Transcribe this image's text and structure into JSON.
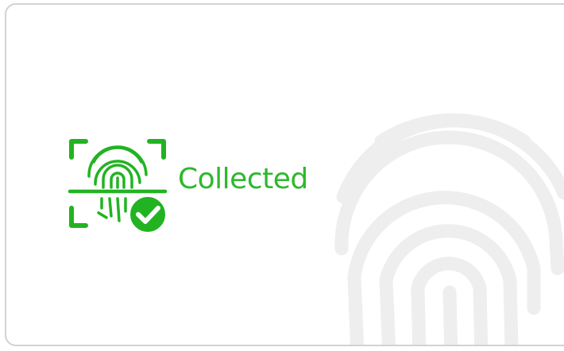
{
  "status": {
    "label": "Collected",
    "icon": "fingerprint-collected-icon",
    "accent_color": "#22b322"
  },
  "background": {
    "icon": "fingerprint-watermark-icon",
    "color": "#ececec"
  }
}
